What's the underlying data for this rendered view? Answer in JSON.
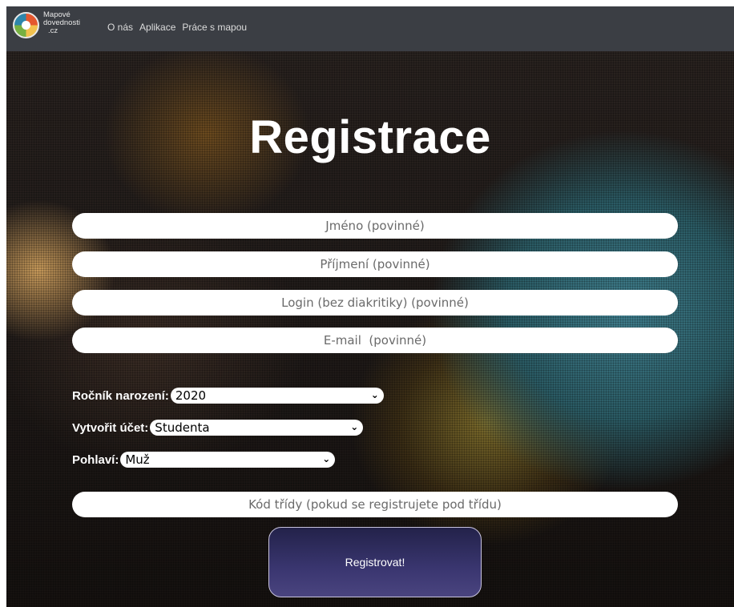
{
  "navbar": {
    "brand_lines": [
      "Mapové",
      "dovednosti",
      ".cz"
    ],
    "links": [
      "O nás",
      "Aplikace",
      "Práce s mapou"
    ]
  },
  "title": "Registrace",
  "fields": {
    "first_name_placeholder": "Jméno (povinné)",
    "last_name_placeholder": "Příjmení (povinné)",
    "login_placeholder": "Login (bez diakritiky) (povinné)",
    "email_placeholder": "E-mail  (povinné)",
    "class_code_placeholder": "Kód třídy (pokud se registrujete pod třídu)"
  },
  "selects": {
    "birth_year": {
      "label": "Ročník narození:",
      "value": "2020"
    },
    "account_type": {
      "label": "Vytvořit účet:",
      "value": "Studenta"
    },
    "gender": {
      "label": "Pohlaví:",
      "value": "Muž"
    }
  },
  "submit_label": "Registrovat!",
  "icons": {
    "logo": "globe-logo-icon",
    "chevron": "chevron-down-icon"
  }
}
